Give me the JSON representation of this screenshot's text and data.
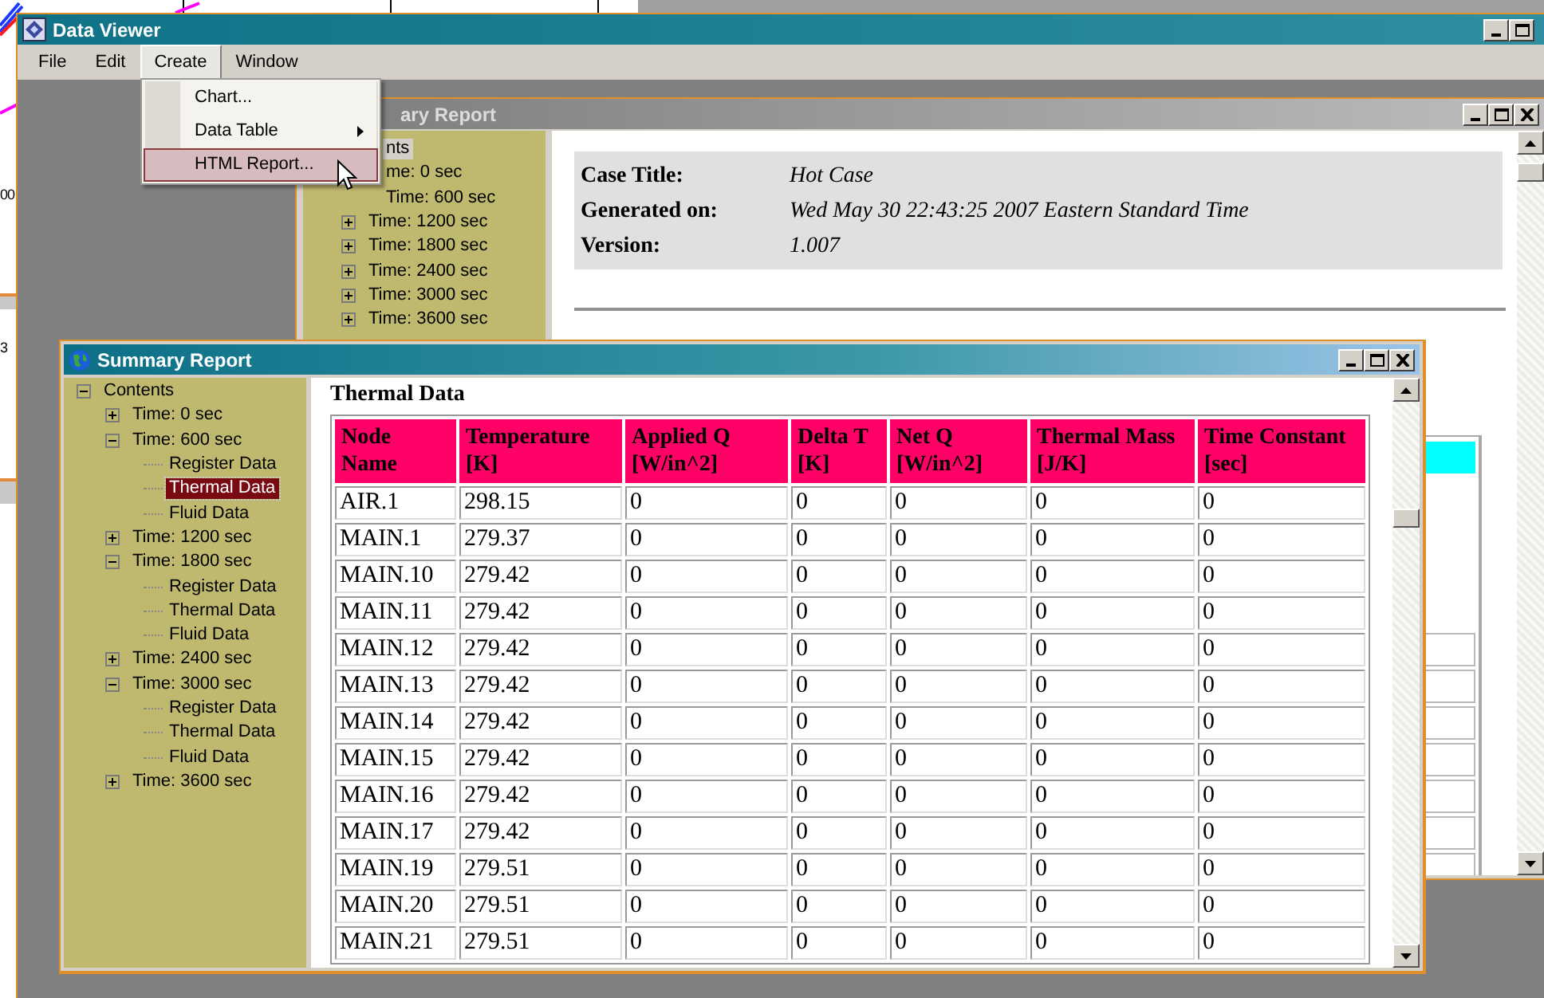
{
  "background_app": {
    "labels": [
      "00",
      "3"
    ]
  },
  "window": {
    "title": "Data Viewer"
  },
  "menu_bar": [
    {
      "label": "File",
      "selected": false
    },
    {
      "label": "Edit",
      "selected": false
    },
    {
      "label": "Create",
      "selected": true
    },
    {
      "label": "Window",
      "selected": false
    }
  ],
  "create_menu": [
    {
      "label": "Chart...",
      "kind": "item",
      "selected": false
    },
    {
      "label": "Data Table",
      "kind": "submenu",
      "selected": false
    },
    {
      "label": "HTML Report...",
      "kind": "item",
      "selected": true
    }
  ],
  "back_report": {
    "title": "ary Report",
    "tree": [
      {
        "label": "nts",
        "selected": true
      },
      {
        "label": "me: 0 sec",
        "selected": false
      },
      {
        "label": "Time: 600 sec",
        "selected": false
      },
      {
        "label": "Time: 1200 sec",
        "expanded": false,
        "selected": false
      },
      {
        "label": "Time: 1800 sec",
        "expanded": false,
        "selected": false
      },
      {
        "label": "Time: 2400 sec",
        "expanded": false,
        "selected": false
      },
      {
        "label": "Time: 3000 sec",
        "expanded": false,
        "selected": false
      },
      {
        "label": "Time: 3600 sec",
        "expanded": false,
        "selected": false
      }
    ],
    "info": [
      {
        "label": "Case Title:",
        "value": "Hot Case"
      },
      {
        "label": "Generated on:",
        "value": "Wed May 30 22:43:25 2007 Eastern Standard Time"
      },
      {
        "label": "Version:",
        "value": "1.007"
      }
    ]
  },
  "front_report": {
    "title": "Summary Report",
    "tree": [
      {
        "label": "Contents",
        "expanded": true,
        "selected": false,
        "children": [
          {
            "label": "Time: 0 sec",
            "expanded": false,
            "selected": false
          },
          {
            "label": "Time: 600 sec",
            "expanded": true,
            "selected": false,
            "children": [
              {
                "label": "Register Data",
                "selected": false
              },
              {
                "label": "Thermal Data",
                "selected": true
              },
              {
                "label": "Fluid Data",
                "selected": false
              }
            ]
          },
          {
            "label": "Time: 1200 sec",
            "expanded": false,
            "selected": false
          },
          {
            "label": "Time: 1800 sec",
            "expanded": true,
            "selected": false,
            "children": [
              {
                "label": "Register Data",
                "selected": false
              },
              {
                "label": "Thermal Data",
                "selected": false
              },
              {
                "label": "Fluid Data",
                "selected": false
              }
            ]
          },
          {
            "label": "Time: 2400 sec",
            "expanded": false,
            "selected": false
          },
          {
            "label": "Time: 3000 sec",
            "expanded": true,
            "selected": false,
            "children": [
              {
                "label": "Register Data",
                "selected": false
              },
              {
                "label": "Thermal Data",
                "selected": false
              },
              {
                "label": "Fluid Data",
                "selected": false
              }
            ]
          },
          {
            "label": "Time: 3600 sec",
            "expanded": false,
            "selected": false
          }
        ]
      }
    ],
    "heading": "Thermal Data",
    "table": {
      "columns": [
        "Node Name",
        "Temperature [K]",
        "Applied Q [W/in^2]",
        "Delta T [K]",
        "Net Q [W/in^2]",
        "Thermal Mass [J/K]",
        "Time Constant [sec]"
      ],
      "rows": [
        [
          "AIR.1",
          "298.15",
          "0",
          "0",
          "0",
          "0",
          "0"
        ],
        [
          "MAIN.1",
          "279.37",
          "0",
          "0",
          "0",
          "0",
          "0"
        ],
        [
          "MAIN.10",
          "279.42",
          "0",
          "0",
          "0",
          "0",
          "0"
        ],
        [
          "MAIN.11",
          "279.42",
          "0",
          "0",
          "0",
          "0",
          "0"
        ],
        [
          "MAIN.12",
          "279.42",
          "0",
          "0",
          "0",
          "0",
          "0"
        ],
        [
          "MAIN.13",
          "279.42",
          "0",
          "0",
          "0",
          "0",
          "0"
        ],
        [
          "MAIN.14",
          "279.42",
          "0",
          "0",
          "0",
          "0",
          "0"
        ],
        [
          "MAIN.15",
          "279.42",
          "0",
          "0",
          "0",
          "0",
          "0"
        ],
        [
          "MAIN.16",
          "279.42",
          "0",
          "0",
          "0",
          "0",
          "0"
        ],
        [
          "MAIN.17",
          "279.42",
          "0",
          "0",
          "0",
          "0",
          "0"
        ],
        [
          "MAIN.19",
          "279.51",
          "0",
          "0",
          "0",
          "0",
          "0"
        ],
        [
          "MAIN.20",
          "279.51",
          "0",
          "0",
          "0",
          "0",
          "0"
        ],
        [
          "MAIN.21",
          "279.51",
          "0",
          "0",
          "0",
          "0",
          "0"
        ]
      ]
    }
  }
}
